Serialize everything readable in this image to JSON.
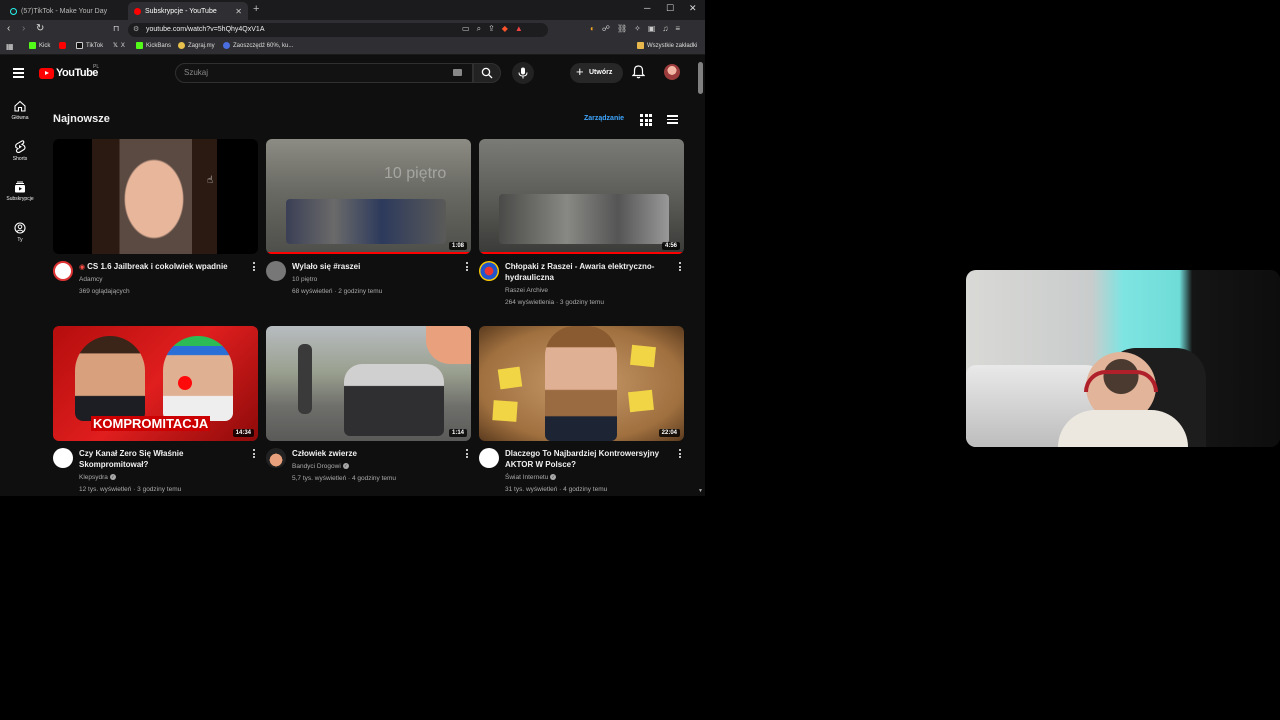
{
  "tabs": [
    {
      "title": "(57)TikTok - Make Your Day",
      "active": false
    },
    {
      "title": "Subskrypcje - YouTube",
      "active": true
    }
  ],
  "address_bar": {
    "url": "youtube.com/watch?v=5hQhy4QxV1A"
  },
  "bookmarks": [
    "Kick",
    "TikTok",
    "X",
    "KickBans",
    "Zagraj.my",
    "Zaoszczędź 60%, ku..."
  ],
  "bookmarks_all": "Wszystkie zakładki",
  "youtube": {
    "logo_text": "YouTube",
    "country": "PL",
    "search_placeholder": "Szukaj",
    "create_label": "Utwórz"
  },
  "sidebar": [
    {
      "label": "Główna",
      "icon": "home-icon"
    },
    {
      "label": "Shorts",
      "icon": "shorts-icon"
    },
    {
      "label": "Subskrypcje",
      "icon": "subscriptions-icon"
    },
    {
      "label": "Ty",
      "icon": "you-icon"
    }
  ],
  "section": {
    "title": "Najnowsze",
    "manage_label": "Zarządzanie"
  },
  "videos": [
    {
      "title": "CS 1.6 Jailbreak i cokolwiek wpadnie",
      "channel": "Adamcy",
      "meta": "369 oglądających",
      "duration": "",
      "live": true
    },
    {
      "title": "Wylało się #raszei",
      "channel": "10 piętro",
      "meta": "68 wyświetleń · 2 godziny temu",
      "duration": "1:08",
      "live": false,
      "thumb_text": "10 piętro"
    },
    {
      "title": "Chłopaki z Raszei - Awaria elektryczno-hydrauliczna",
      "channel": "Raszei Archive",
      "meta": "264 wyświetlenia · 3 godziny temu",
      "duration": "4:56",
      "live": false
    },
    {
      "title": "Czy Kanał Zero Się Właśnie Skompromitował?",
      "channel": "Klepsydra",
      "meta": "12 tys. wyświetleń · 3 godziny temu",
      "duration": "14:34",
      "live": false,
      "thumb_text": "KOMPROMITACJA"
    },
    {
      "title": "Człowiek zwierze",
      "channel": "Bandyci Drogowi",
      "meta": "5,7 tys. wyświetleń · 4 godziny temu",
      "duration": "1:14",
      "live": false
    },
    {
      "title": "Dlaczego To Najbardziej Kontrowersyjny AKTOR W Polsce?",
      "channel": "Świat Internetu",
      "meta": "31 tys. wyświetleń · 4 godziny temu",
      "duration": "22:04",
      "live": false
    }
  ],
  "colors": {
    "accent": "#ff0000",
    "link": "#3ea6ff",
    "background": "#0f0f0f"
  }
}
